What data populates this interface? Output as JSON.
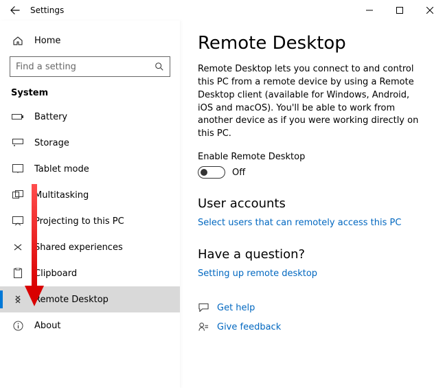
{
  "window": {
    "title": "Settings"
  },
  "sidebar": {
    "home_label": "Home",
    "search_placeholder": "Find a setting",
    "section_label": "System",
    "items": [
      {
        "label": "Battery"
      },
      {
        "label": "Storage"
      },
      {
        "label": "Tablet mode"
      },
      {
        "label": "Multitasking"
      },
      {
        "label": "Projecting to this PC"
      },
      {
        "label": "Shared experiences"
      },
      {
        "label": "Clipboard"
      },
      {
        "label": "Remote Desktop"
      },
      {
        "label": "About"
      }
    ]
  },
  "content": {
    "page_title": "Remote Desktop",
    "description": "Remote Desktop lets you connect to and control this PC from a remote device by using a Remote Desktop client (available for Windows, Android, iOS and macOS). You'll be able to work from another device as if you were working directly on this PC.",
    "toggle_label": "Enable Remote Desktop",
    "toggle_state": "Off",
    "user_accounts_heading": "User accounts",
    "user_accounts_link": "Select users that can remotely access this PC",
    "question_heading": "Have a question?",
    "question_link": "Setting up remote desktop",
    "help": {
      "get_help": "Get help",
      "give_feedback": "Give feedback"
    }
  }
}
